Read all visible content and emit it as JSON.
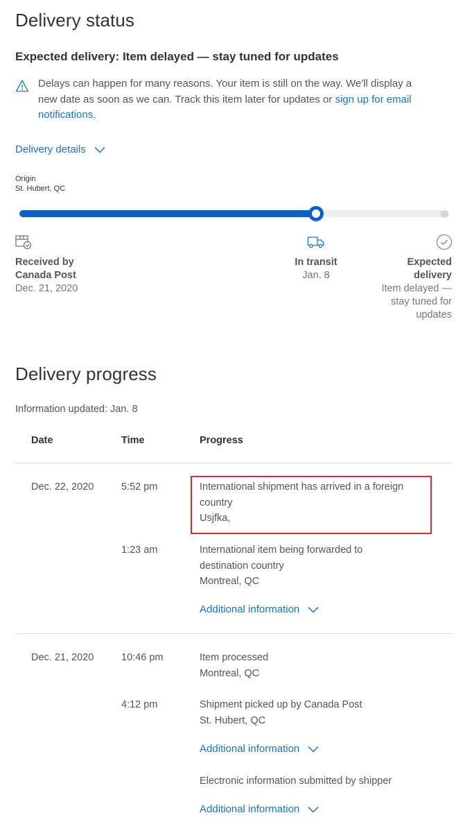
{
  "status": {
    "title": "Delivery status",
    "expected_heading": "Expected delivery: Item delayed — stay tuned for updates",
    "alert_text_lines": [
      "Delays can happen for many reasons. Your item is still on the way. We'll display a",
      "new date as soon as we can. Track this item later for updates or"
    ],
    "alert_link_part1": "sign up for email",
    "alert_link_part2": "notifications.",
    "details_toggle": "Delivery details",
    "origin_label": "Origin",
    "origin_value": "St. Hubert, QC"
  },
  "tracker": {
    "progress_fraction": 0.69,
    "accent_color": "#0a5fc9",
    "track_color": "#eeeeee",
    "steps": [
      {
        "icon": "package-received-icon",
        "title_lines": [
          "Received by",
          "Canada Post"
        ],
        "sub_lines": [
          "Dec. 21, 2020"
        ]
      },
      {
        "icon": "delivery-truck-icon",
        "title_lines": [
          "In transit"
        ],
        "sub_lines": [
          "Jan. 8"
        ]
      },
      {
        "icon": "checkmark-circle-icon",
        "title_lines": [
          "Expected",
          "delivery"
        ],
        "sub_lines": [
          "Item delayed —",
          "stay tuned for",
          "updates"
        ]
      }
    ]
  },
  "progress": {
    "title": "Delivery progress",
    "updated": "Information updated: Jan. 8",
    "headers": [
      "Date",
      "Time",
      "Progress"
    ],
    "additional_info": "Additional information",
    "groups": [
      {
        "date": "Dec. 22, 2020",
        "events": [
          {
            "time": "5:52 pm",
            "lines": [
              "International shipment has arrived in a foreign",
              "country",
              "Usjfka,"
            ],
            "highlighted": true
          },
          {
            "time": "1:23 am",
            "lines": [
              "International item being forwarded to",
              "destination country",
              "Montreal, QC"
            ],
            "additional": true
          }
        ]
      },
      {
        "date": "Dec. 21, 2020",
        "events": [
          {
            "time": "10:46 pm",
            "lines": [
              "Item processed",
              "Montreal, QC"
            ]
          },
          {
            "time": "4:12 pm",
            "lines": [
              "Shipment picked up by Canada Post",
              "St. Hubert, QC"
            ],
            "additional": true
          },
          {
            "time": "",
            "lines": [
              "Electronic information submitted by shipper"
            ],
            "additional": true
          }
        ]
      }
    ]
  }
}
